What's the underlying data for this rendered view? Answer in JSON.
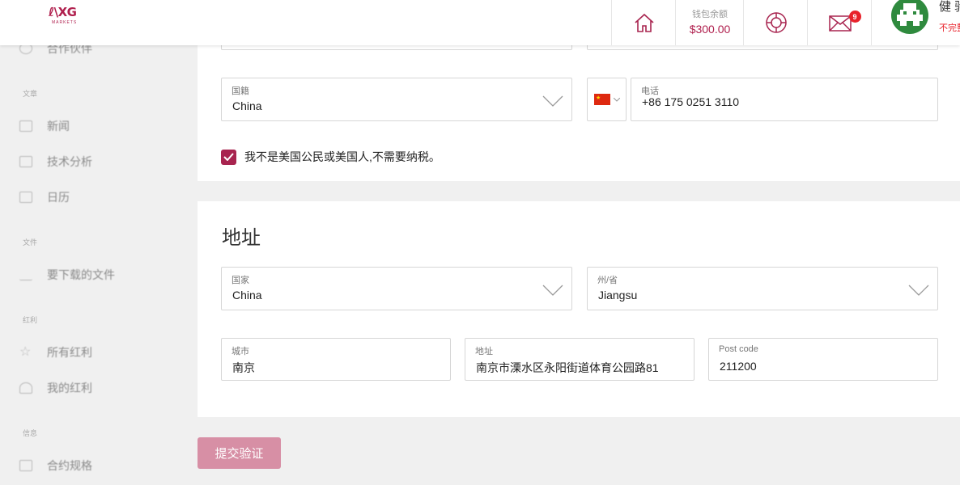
{
  "header": {
    "logo_text": "XG",
    "logo_prefix": "ℓ\\",
    "logo_subtext": "MARKETS",
    "wallet_label": "钱包余额",
    "wallet_amount": "$300.00",
    "mail_badge": "9",
    "user_name": "健 驹",
    "user_status": "不完整"
  },
  "sidebar": {
    "items": [
      {
        "label": "合作伙伴",
        "icon": "partner-icon"
      },
      {
        "section": "文章"
      },
      {
        "label": "新闻",
        "icon": "news-icon"
      },
      {
        "label": "技术分析",
        "icon": "analysis-icon"
      },
      {
        "label": "日历",
        "icon": "calendar-icon"
      },
      {
        "section": "文件"
      },
      {
        "label": "要下载的文件",
        "icon": "download-icon"
      },
      {
        "section": "红利"
      },
      {
        "label": "所有红利",
        "icon": "star-icon"
      },
      {
        "label": "我的红利",
        "icon": "user-icon"
      },
      {
        "section": "信息"
      },
      {
        "label": "合约规格",
        "icon": "contract-icon"
      }
    ]
  },
  "personal": {
    "nationality_label": "国籍",
    "nationality_value": "China",
    "phone_label": "电话",
    "phone_value": "+86 175 0251 3110",
    "flag_icon": "china-flag-icon",
    "tax_checkbox_label": "我不是美国公民或美国人,不需要纳税。",
    "tax_checked": true
  },
  "address": {
    "title": "地址",
    "country_label": "国家",
    "country_value": "China",
    "state_label": "州/省",
    "state_value": "Jiangsu",
    "city_label": "城市",
    "city_value": "南京",
    "street_label": "地址",
    "street_value": "南京市溧水区永阳街道体育公园路81",
    "postcode_label": "Post code",
    "postcode_value": "211200"
  },
  "submit_label": "提交验证",
  "colors": {
    "accent": "#a8244f",
    "submit_disabled": "#d78fa5",
    "badge": "#e8212a",
    "avatar": "#2f8a3e"
  }
}
